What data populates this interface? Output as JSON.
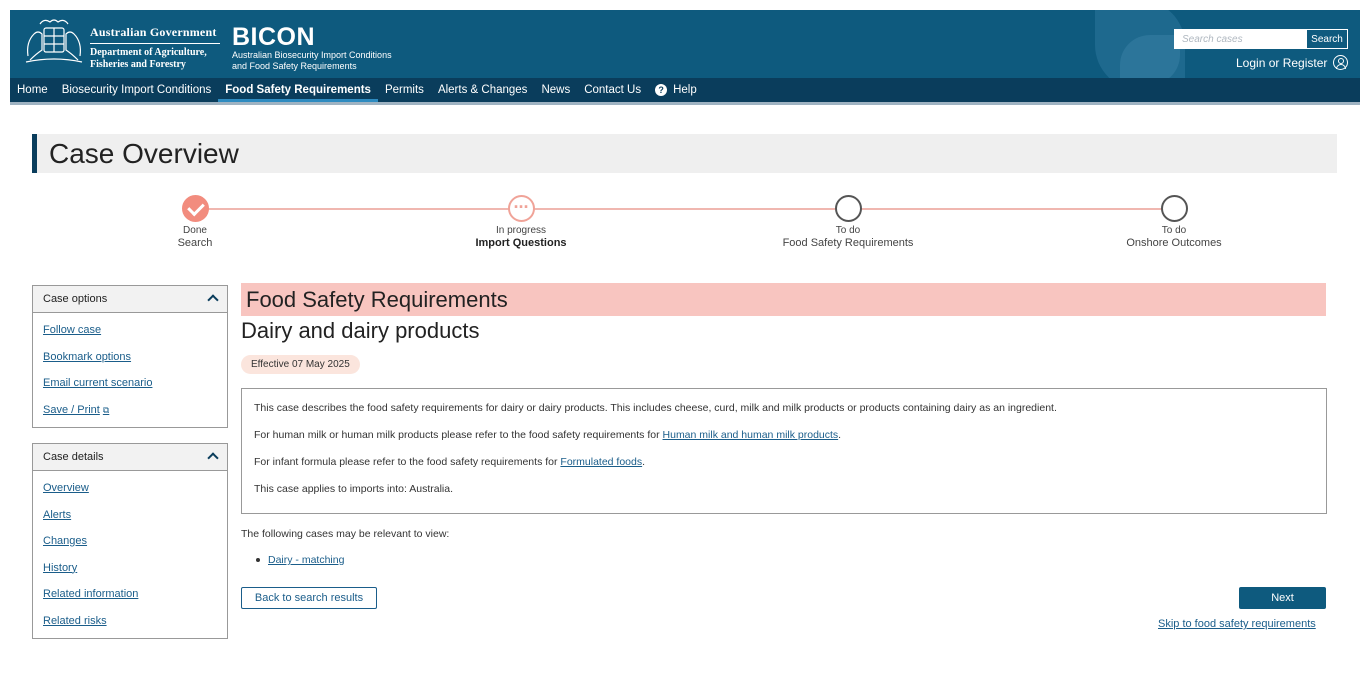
{
  "header": {
    "gov_line1": "Australian Government",
    "gov_line2": "Department of Agriculture,",
    "gov_line3": "Fisheries and Forestry",
    "app_title": "BICON",
    "app_subtitle_line1": "Australian Biosecurity Import Conditions",
    "app_subtitle_line2": "and Food Safety Requirements",
    "search_placeholder": "Search cases",
    "search_button": "Search",
    "login_label": "Login or Register"
  },
  "nav": {
    "items": [
      {
        "label": "Home"
      },
      {
        "label": "Biosecurity Import Conditions"
      },
      {
        "label": "Food Safety Requirements"
      },
      {
        "label": "Permits"
      },
      {
        "label": "Alerts & Changes"
      },
      {
        "label": "News"
      },
      {
        "label": "Contact Us"
      },
      {
        "label": "Help"
      }
    ],
    "active_index": 2
  },
  "page_title": "Case Overview",
  "steps": [
    {
      "status": "Done",
      "name": "Search",
      "state": "done"
    },
    {
      "status": "In progress",
      "name": "Import Questions",
      "state": "progress"
    },
    {
      "status": "To do",
      "name": "Food Safety Requirements",
      "state": "todo"
    },
    {
      "status": "To do",
      "name": "Onshore Outcomes",
      "state": "todo"
    }
  ],
  "case_options": {
    "title": "Case options",
    "links": [
      {
        "label": "Follow case"
      },
      {
        "label": "Bookmark options"
      },
      {
        "label": "Email current scenario"
      },
      {
        "label": "Save / Print"
      }
    ]
  },
  "case_details": {
    "title": "Case details",
    "links": [
      {
        "label": "Overview"
      },
      {
        "label": "Alerts"
      },
      {
        "label": "Changes"
      },
      {
        "label": "History"
      },
      {
        "label": "Related information"
      },
      {
        "label": "Related risks"
      }
    ]
  },
  "main": {
    "banner": "Food Safety Requirements",
    "subtitle": "Dairy and dairy products",
    "effective": "Effective 07 May 2025",
    "desc1": "This case describes the food safety requirements for dairy or dairy products. This includes cheese, curd, milk and milk products or products containing dairy as an ingredient.",
    "desc2_prefix": "For human milk or human milk products please refer to the food safety requirements for ",
    "desc2_link": "Human milk and human milk products",
    "desc2_suffix": ".",
    "desc3_prefix": "For infant formula please refer to the food safety requirements for ",
    "desc3_link": "Formulated foods",
    "desc3_suffix": ".",
    "desc4": "This case applies to imports into: Australia.",
    "related_intro": "The following cases may be relevant to view:",
    "related_items": [
      {
        "label": "Dairy - matching"
      }
    ],
    "back_button": "Back to search results",
    "next_button": "Next",
    "skip_link": "Skip to food safety requirements"
  },
  "colors": {
    "header_bg": "#0e5a7e",
    "nav_bg": "#0a3d5c",
    "banner_bg": "#f8c5c0",
    "step_done": "#f28c7e",
    "link": "#1a5d8a"
  }
}
